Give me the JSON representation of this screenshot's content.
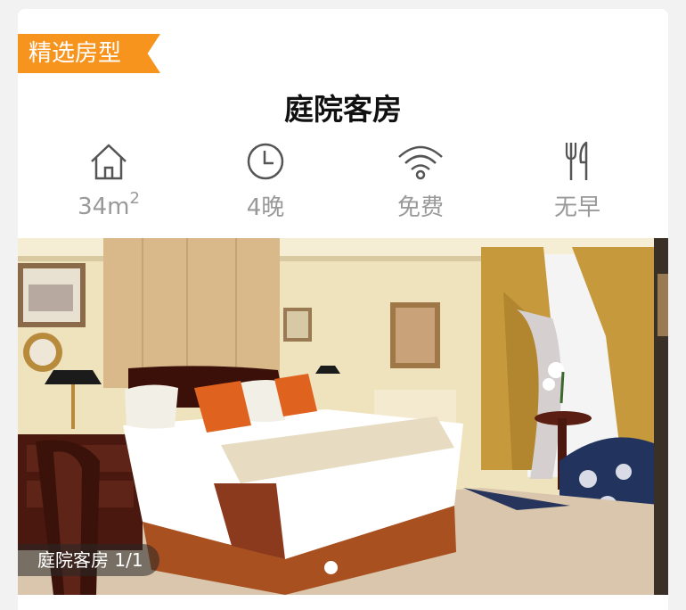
{
  "badge": "精选房型",
  "room_title": "庭院客房",
  "features": [
    {
      "icon": "house-icon",
      "label": "34m",
      "superscript": "2"
    },
    {
      "icon": "clock-icon",
      "label": "4晚"
    },
    {
      "icon": "wifi-icon",
      "label": "免费"
    },
    {
      "icon": "fork-knife-icon",
      "label": "无早"
    }
  ],
  "gallery": {
    "caption": "庭院客房 1/1"
  },
  "colors": {
    "accent": "#f7941d",
    "muted_text": "#999999"
  }
}
